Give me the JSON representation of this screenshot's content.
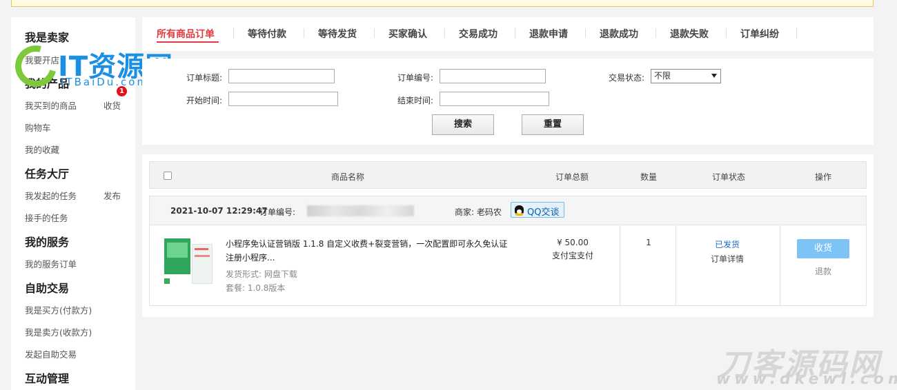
{
  "sidebar": {
    "sections": [
      {
        "title": "我是卖家"
      },
      {
        "title": "我的产品"
      },
      {
        "title": "任务大厅"
      },
      {
        "title": "我的服务"
      },
      {
        "title": "自助交易"
      },
      {
        "title": "互动管理"
      }
    ],
    "items": {
      "seller_open": "我要开店",
      "bought": "我买到的商品",
      "receive": "收货",
      "receive_badge": "1",
      "cart": "购物车",
      "favorites": "我的收藏",
      "my_tasks": "我发起的任务",
      "publish": "发布",
      "taken_tasks": "接手的任务",
      "service_orders": "我的服务订单",
      "buyer": "我是买方(付款方)",
      "seller": "我是卖方(收款方)",
      "self_trade": "发起自助交易"
    }
  },
  "watermark": {
    "logo_text": "IT资源网",
    "logo_sub": "ITBaiDu.com",
    "corner_text": "刀客源码网",
    "corner_sub": "www.dkewl.com"
  },
  "tabs": [
    {
      "label": "所有商品订单",
      "active": true
    },
    {
      "label": "等待付款"
    },
    {
      "label": "等待发货"
    },
    {
      "label": "买家确认"
    },
    {
      "label": "交易成功"
    },
    {
      "label": "退款申请"
    },
    {
      "label": "退款成功"
    },
    {
      "label": "退款失败"
    },
    {
      "label": "订单纠纷"
    }
  ],
  "filter": {
    "title_label": "订单标题:",
    "order_no_label": "订单编号:",
    "status_label": "交易状态:",
    "status_value": "不限",
    "start_label": "开始时间:",
    "end_label": "结束时间:",
    "search_button": "搜索",
    "reset_button": "重置"
  },
  "table": {
    "headers": {
      "name": "商品名称",
      "total": "订单总额",
      "qty": "数量",
      "status": "订单状态",
      "action": "操作"
    }
  },
  "order": {
    "datetime": "2021-10-07 12:29:47",
    "order_no_label": "订单编号:",
    "merchant": "商家: 老码农",
    "chat_button": "QQ交谈",
    "product_title": "小程序免认证营销版 1.1.8 自定义收费+裂变营销，一次配置即可永久免认证注册小程序...",
    "delivery": "发货形式: 网盘下载",
    "package": "套餐: 1.0.8版本",
    "price": "¥ 50.00",
    "pay_method": "支付宝支付",
    "quantity": "1",
    "status": "已发货",
    "detail_link": "订单详情",
    "receive_button": "收货",
    "refund_link": "退款"
  },
  "colors": {
    "accent": "#e4393c",
    "link": "#1a6ecf",
    "receive_button": "#7dc3f5"
  }
}
